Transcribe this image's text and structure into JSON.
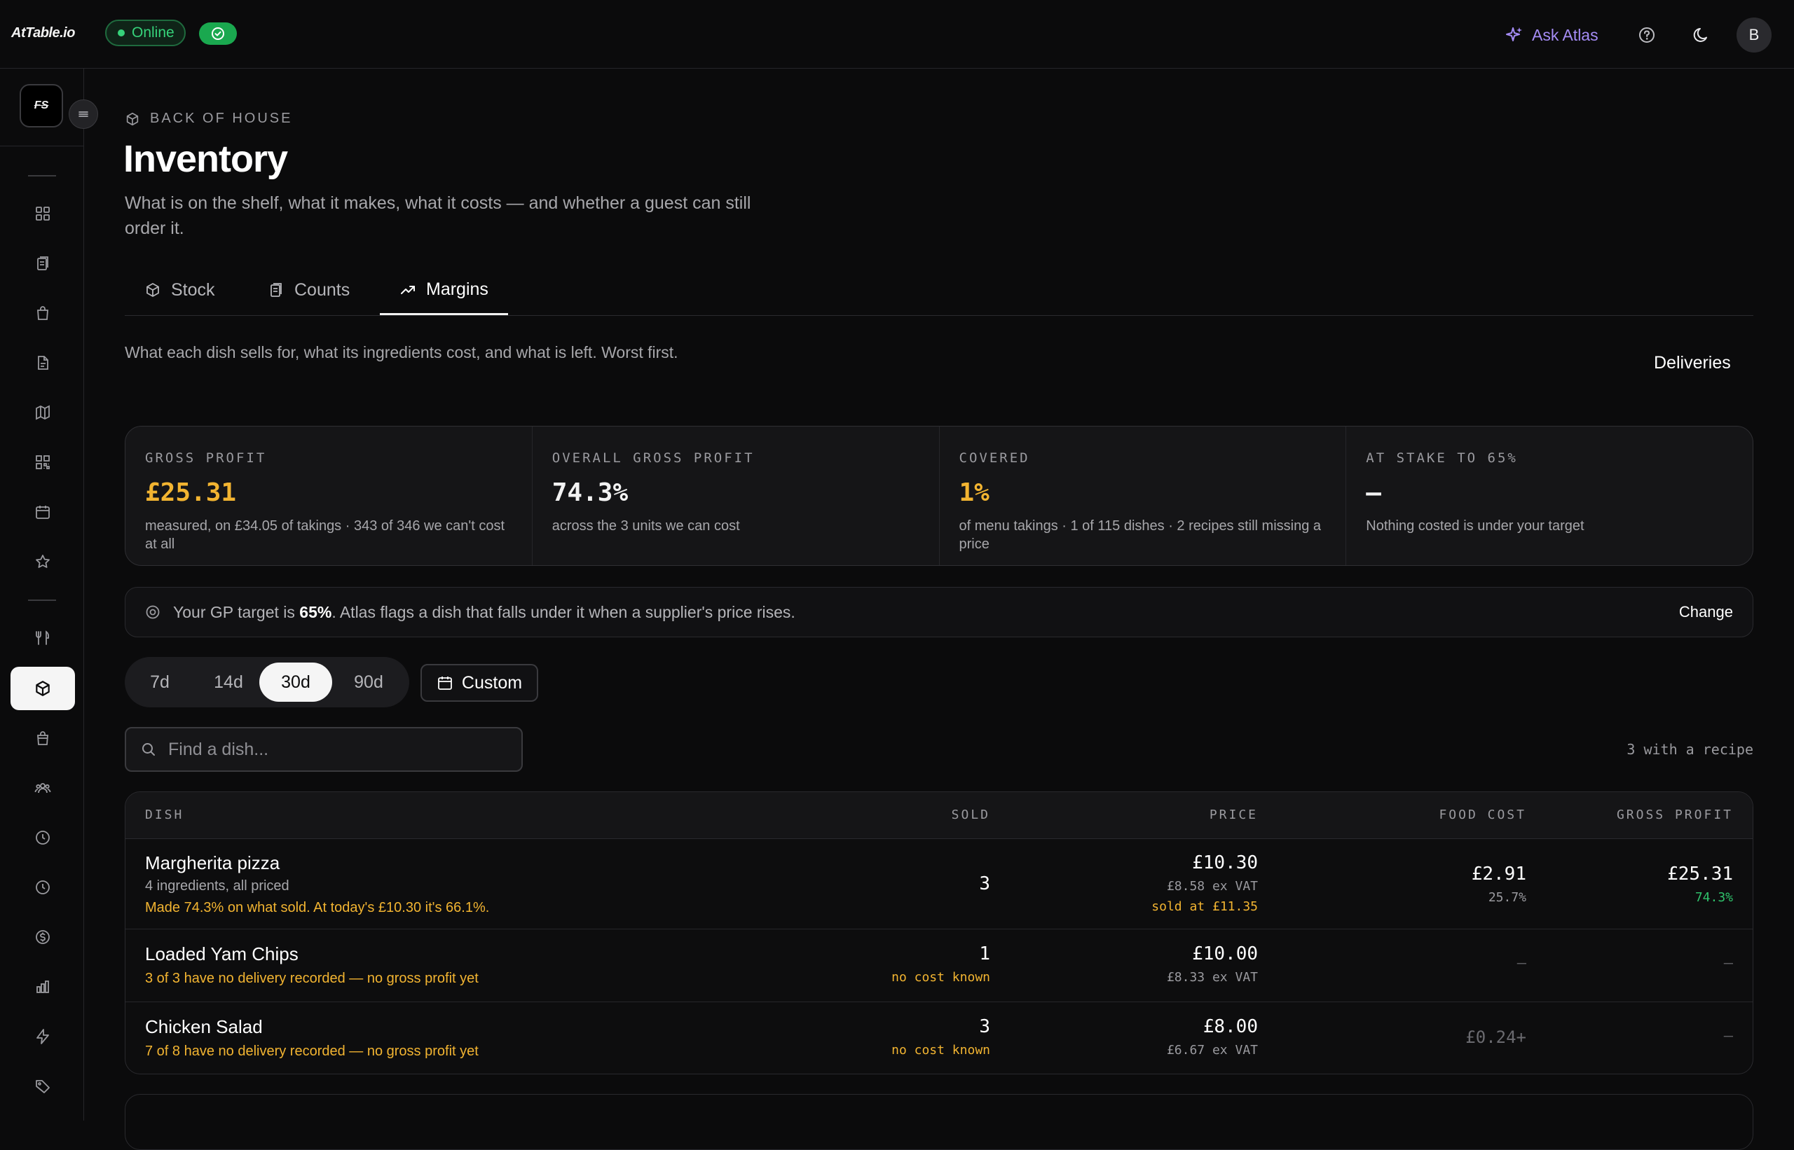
{
  "app": {
    "logo": "AtTable.io",
    "status": "Online",
    "ask_atlas": "Ask Atlas",
    "avatar_initial": "B",
    "venue_logo": "FS"
  },
  "page": {
    "breadcrumb": "BACK OF HOUSE",
    "title": "Inventory",
    "subtitle": "What is on the shelf, what it makes, what it costs — and whether a guest can still order it."
  },
  "tabs": [
    {
      "label": "Stock",
      "active": false
    },
    {
      "label": "Counts",
      "active": false
    },
    {
      "label": "Margins",
      "active": true
    }
  ],
  "margins": {
    "description": "What each dish sells for, what its ingredients cost, and what is left. Worst first.",
    "deliveries_link": "Deliveries"
  },
  "stats": [
    {
      "label": "GROSS PROFIT",
      "value": "£25.31",
      "note": "measured, on £34.05 of takings · 343 of 346 we can't cost at all"
    },
    {
      "label": "OVERALL GROSS PROFIT",
      "value": "74.3%",
      "note": "across the 3 units we can cost"
    },
    {
      "label": "COVERED",
      "value": "1%",
      "note": "of menu takings · 1 of 115 dishes · 2 recipes still missing a price"
    },
    {
      "label": "AT STAKE TO 65%",
      "value": "—",
      "note": "Nothing costed is under your target"
    }
  ],
  "gp_target": {
    "prefix": "Your GP target is ",
    "value": "65%",
    "suffix": ". Atlas flags a dish that falls under it when a supplier's price rises.",
    "change_label": "Change"
  },
  "range": {
    "options": [
      "7d",
      "14d",
      "30d",
      "90d"
    ],
    "selected": "30d",
    "custom_label": "Custom"
  },
  "search": {
    "placeholder": "Find a dish...",
    "value": ""
  },
  "recipe_count": "3 with a recipe",
  "table": {
    "headers": [
      "DISH",
      "SOLD",
      "PRICE",
      "FOOD COST",
      "GROSS PROFIT"
    ],
    "rows": [
      {
        "dish": "Margherita pizza",
        "sub": "4 ingredients, all priced",
        "warn": "Made 74.3% on what sold. At today's £10.30 it's 66.1%.",
        "sold": "3",
        "price": "£10.30",
        "price_ex_vat": "£8.58 ex VAT",
        "price_note": "sold at £11.35",
        "food_cost": "£2.91",
        "food_cost_pct": "25.7%",
        "gross_profit": "£25.31",
        "gross_profit_pct": "74.3%"
      },
      {
        "dish": "Loaded Yam Chips",
        "warn": "3 of 3 have no delivery recorded — no gross profit yet",
        "sold": "1",
        "sold_note": "no cost known",
        "price": "£10.00",
        "price_ex_vat": "£8.33 ex VAT",
        "food_cost": "–",
        "gross_profit": "–"
      },
      {
        "dish": "Chicken Salad",
        "warn": "7 of 8 have no delivery recorded — no gross profit yet",
        "sold": "3",
        "sold_note": "no cost known",
        "price": "£8.00",
        "price_ex_vat": "£6.67 ex VAT",
        "food_cost": "£0.24+",
        "gross_profit": "–"
      }
    ]
  },
  "colors": {
    "accent_yellow": "#f2b431",
    "online_green": "#36d27a",
    "atlas_purple": "#a58cf5",
    "positive_green": "#2fc16b"
  },
  "sidebar_icons": [
    "grid-icon",
    "clipboard-icon",
    "bag-icon",
    "document-icon",
    "map-icon",
    "qr-code-icon",
    "calendar-icon",
    "star-icon",
    "utensils-icon",
    "box-icon",
    "shopping-bag-icon",
    "users-icon",
    "clock-icon",
    "history-icon",
    "dollar-icon",
    "bar-chart-icon",
    "bolt-icon",
    "tag-icon"
  ]
}
